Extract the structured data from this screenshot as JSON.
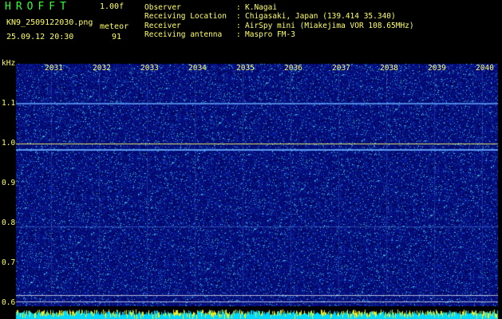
{
  "app": {
    "title": "HROFFT",
    "version": "1.00f"
  },
  "file": {
    "name": "KN9_2509122030.png",
    "timestamp": "25.09.12 20:30"
  },
  "mode": {
    "label": "meteor",
    "value": "91"
  },
  "meta": [
    {
      "label": "Observer",
      "value": "K.Nagai"
    },
    {
      "label": "Receiving Location",
      "value": "Chigasaki, Japan (139.414 35.340)"
    },
    {
      "label": "Receiver",
      "value": "AirSpy mini (Miakejima VOR 108.65MHz)"
    },
    {
      "label": "Receiving antenna",
      "value": "Maspro FM-3"
    }
  ],
  "axis": {
    "unit": "kHz",
    "y_ticks": [
      "1.1",
      "1.0",
      "0.9",
      "0.8",
      "0.7",
      "0.6"
    ],
    "x_ticks": [
      "2031",
      "2032",
      "2033",
      "2034",
      "2035",
      "2036",
      "2037",
      "2038",
      "2039",
      "2040"
    ]
  },
  "colors": {
    "background_noise": "#0a0a88",
    "signal_line": "#66aaff",
    "reference_line": "#ffff66",
    "cyan_bar": "#00d8ff",
    "label_yellow": "#ffff66",
    "title_green": "#33ff33"
  }
}
